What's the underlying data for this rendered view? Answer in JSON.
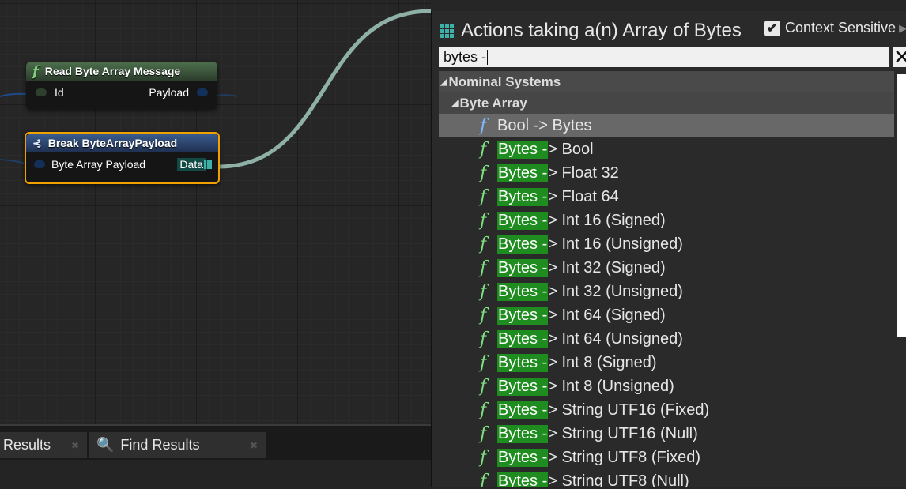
{
  "graph": {
    "nodes": {
      "read": {
        "title": "Read Byte Array Message",
        "pin_in": "Id",
        "pin_out": "Payload"
      },
      "break": {
        "title": "Break ByteArrayPayload",
        "pin_in": "Byte Array Payload",
        "pin_out": "Data"
      }
    }
  },
  "bottom_tabs": [
    {
      "label": "Results"
    },
    {
      "label": "Find Results"
    }
  ],
  "menu": {
    "title": "Actions taking a(n) Array of Bytes",
    "context_sensitive_label": "Context Sensitive",
    "context_sensitive_checked": true,
    "search_value": "bytes -",
    "categories": {
      "nominal": "Nominal Systems",
      "byte_array": "Byte Array"
    },
    "items": [
      {
        "match": "",
        "rest": "Bool -> Bytes"
      },
      {
        "match": "Bytes -",
        "rest": "> Bool"
      },
      {
        "match": "Bytes -",
        "rest": "> Float 32"
      },
      {
        "match": "Bytes -",
        "rest": "> Float 64"
      },
      {
        "match": "Bytes -",
        "rest": "> Int 16 (Signed)"
      },
      {
        "match": "Bytes -",
        "rest": "> Int 16 (Unsigned)"
      },
      {
        "match": "Bytes -",
        "rest": "> Int 32 (Signed)"
      },
      {
        "match": "Bytes -",
        "rest": "> Int 32 (Unsigned)"
      },
      {
        "match": "Bytes -",
        "rest": "> Int 64 (Signed)"
      },
      {
        "match": "Bytes -",
        "rest": "> Int 64 (Unsigned)"
      },
      {
        "match": "Bytes -",
        "rest": "> Int 8 (Signed)"
      },
      {
        "match": "Bytes -",
        "rest": "> Int 8 (Unsigned)"
      },
      {
        "match": "Bytes -",
        "rest": "> String UTF16 (Fixed)"
      },
      {
        "match": "Bytes -",
        "rest": "> String UTF16 (Null)"
      },
      {
        "match": "Bytes -",
        "rest": "> String UTF8 (Fixed)"
      },
      {
        "match": "Bytes -",
        "rest": "> String UTF8 (Null)"
      }
    ]
  },
  "colors": {
    "accent_selected_border": "#f0a100",
    "wire": "#8fb0a6",
    "match_highlight": "#1e8c1e"
  }
}
